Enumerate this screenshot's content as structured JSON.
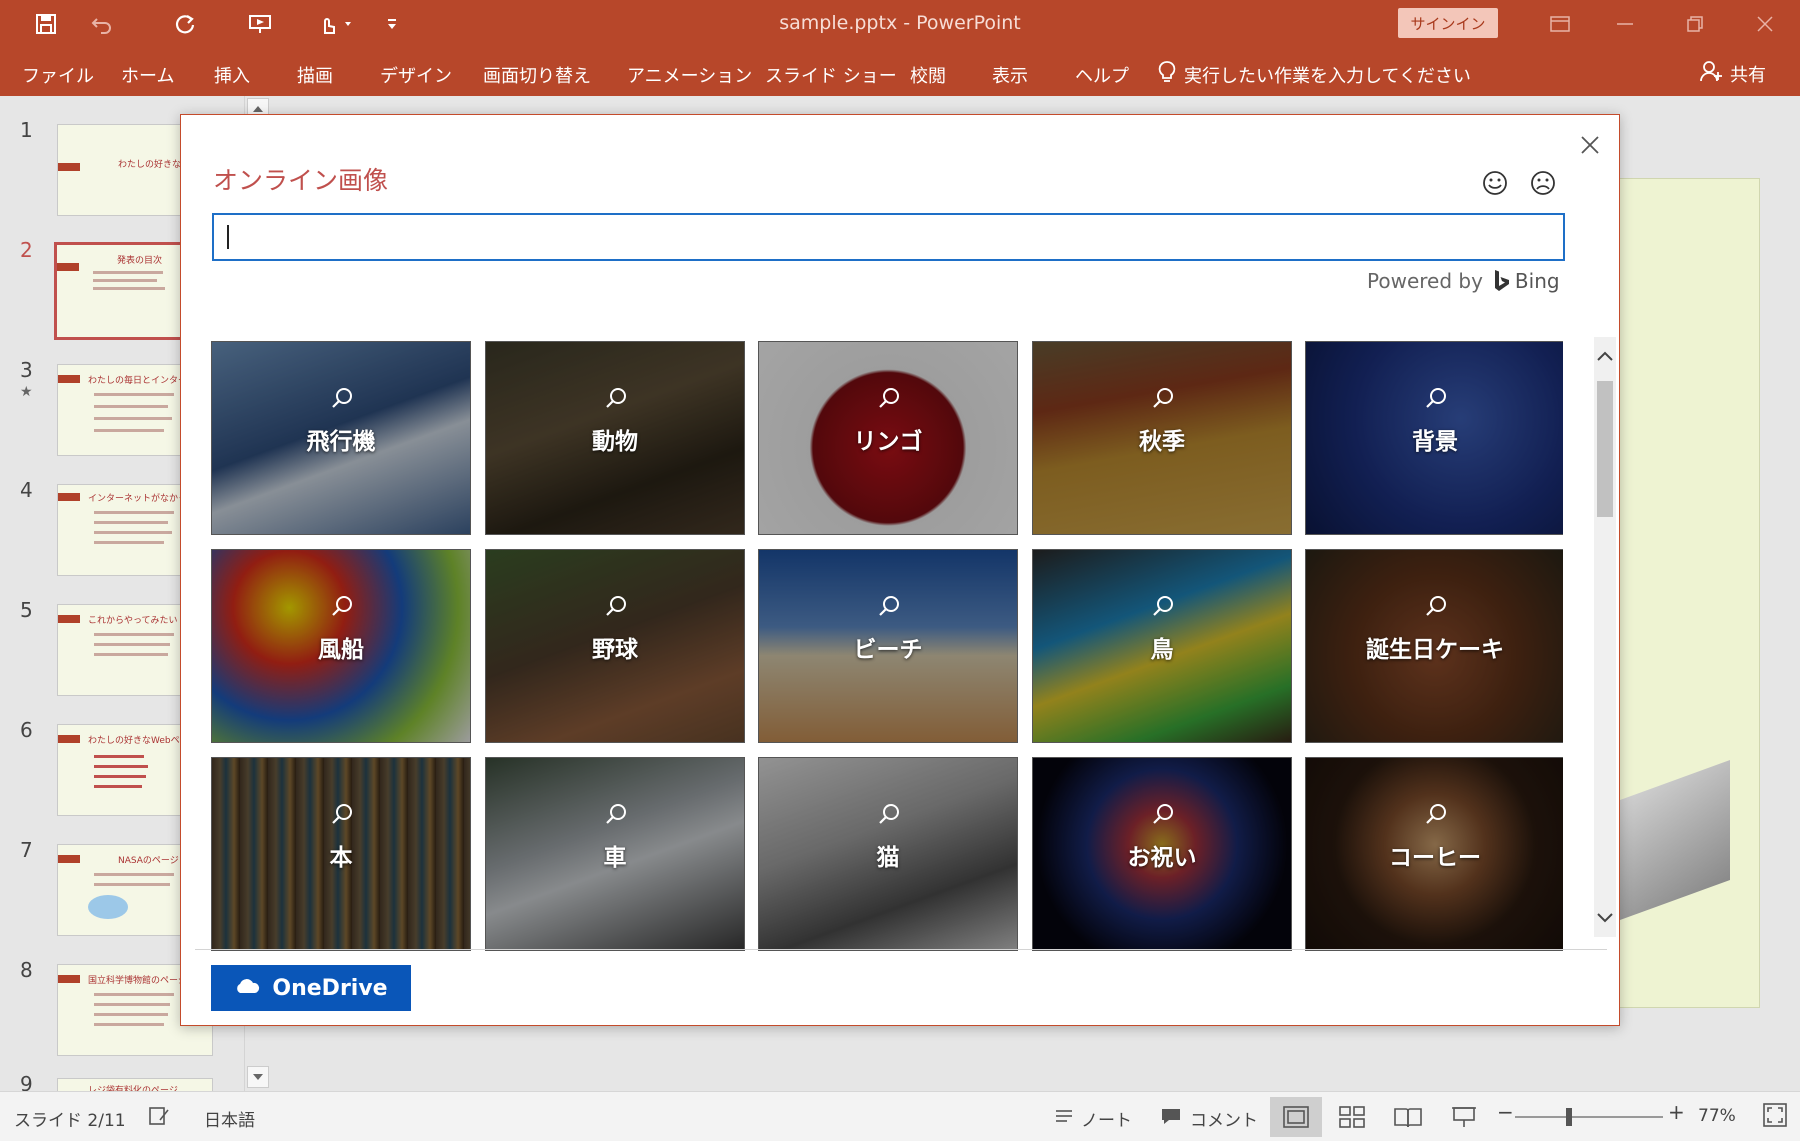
{
  "window": {
    "title": "sample.pptx  -  PowerPoint",
    "signin_label": "サインイン"
  },
  "ribbon": {
    "tabs": [
      "ファイル",
      "ホーム",
      "挿入",
      "描画",
      "デザイン",
      "画面切り替え",
      "アニメーション",
      "スライド ショー",
      "校閲",
      "表示",
      "ヘルプ"
    ],
    "tell_me": "実行したい作業を入力してください",
    "share": "共有"
  },
  "thumbnails": [
    {
      "num": "1",
      "title": "わたしの好きなWebページ"
    },
    {
      "num": "2",
      "title": "発表の目次"
    },
    {
      "num": "3",
      "title": "わたしの毎日とインターネット",
      "star": "★"
    },
    {
      "num": "4",
      "title": "インターネットがなかったら"
    },
    {
      "num": "5",
      "title": "これからやってみたい"
    },
    {
      "num": "6",
      "title": "わたしの好きなWebページ"
    },
    {
      "num": "7",
      "title": "NASAのページ"
    },
    {
      "num": "8",
      "title": "国立科学博物館のページ"
    },
    {
      "num": "9",
      "title": "レジ袋有料化のページ"
    }
  ],
  "dialog": {
    "title": "オンライン画像",
    "search_value": "",
    "powered_by": "Powered by",
    "bing": "Bing",
    "onedrive_label": "OneDrive",
    "tiles": [
      {
        "label": "飛行機",
        "bg": "linear-gradient(160deg,#6a8fb8 0%,#2f4d7a 45%,#c9d3de 60%,#41618c 100%)"
      },
      {
        "label": "動物",
        "bg": "linear-gradient(160deg,#3d3a2a 0%,#5b4d36 40%,#2b2418 70%,#4a3b2a 100%)"
      },
      {
        "label": "リンゴ",
        "bg": "radial-gradient(circle at 50% 55%,#b3121a 0%,#7a0d12 45%,#e8e8e8 47%,#f2f2f2 100%)"
      },
      {
        "label": "秋季",
        "bg": "linear-gradient(170deg,#6b5a3a 0%,#8a3b1e 30%,#b8892f 55%,#caa24a 100%)"
      },
      {
        "label": "背景",
        "bg": "radial-gradient(circle at 60% 40%,#3a5bb0 0%,#1b2f7a 55%,#0e1a4a 100%)"
      },
      {
        "label": "風船",
        "bg": "radial-gradient(circle at 30% 30%,#f0e000 0%,#d62c1b 25%,#1d58b5 50%,#8bc03a 75%,#e6e6e6 100%)"
      },
      {
        "label": "野球",
        "bg": "linear-gradient(160deg,#3f5a2e 0%,#4b3a2a 45%,#8a5a3a 75%,#6a4a30 100%)"
      },
      {
        "label": "ビーチ",
        "bg": "linear-gradient(180deg,#1d4f9a 0%,#5a86c0 40%,#d1c6a8 55%,#c08a52 100%)"
      },
      {
        "label": "鳥",
        "bg": "linear-gradient(160deg,#2a2a2a 0%,#1d7fb3 35%,#d8c02a 55%,#3aa53a 80%,#3a2a1a 100%)"
      },
      {
        "label": "誕生日ケーキ",
        "bg": "radial-gradient(circle at 50% 55%,#8a4a2a 0%,#5a3018 50%,#2a2418 100%)"
      },
      {
        "label": "本",
        "bg": "repeating-linear-gradient(90deg,#4a3a2a 0px,#6a5a40 8px,#2a4a5a 14px,#8a6a3a 22px,#3a2a1a 28px)"
      },
      {
        "label": "車",
        "bg": "linear-gradient(160deg,#3a4a3a 0%,#9aa0a4 40%,#c8cccf 55%,#3a3a3a 100%)"
      },
      {
        "label": "猫",
        "bg": "linear-gradient(160deg,#d8d8d8 0%,#9a9a9a 40%,#4a4a4a 70%,#bdbdbd 100%)"
      },
      {
        "label": "お祝い",
        "bg": "radial-gradient(circle at 50% 45%,#c8a02a 0%,#a0303a 20%,#1a2a6a 45%,#050510 75%)"
      },
      {
        "label": "コーヒー",
        "bg": "radial-gradient(circle at 50% 45%,#c49a6a 0%,#7a4a2a 30%,#2a1a10 60%,#1a100a 100%)"
      }
    ]
  },
  "status": {
    "slide": "スライド 2/11",
    "language": "日本語",
    "notes": "ノート",
    "comments": "コメント",
    "zoom": "77%",
    "zoom_minus": "−",
    "zoom_plus": "+"
  }
}
